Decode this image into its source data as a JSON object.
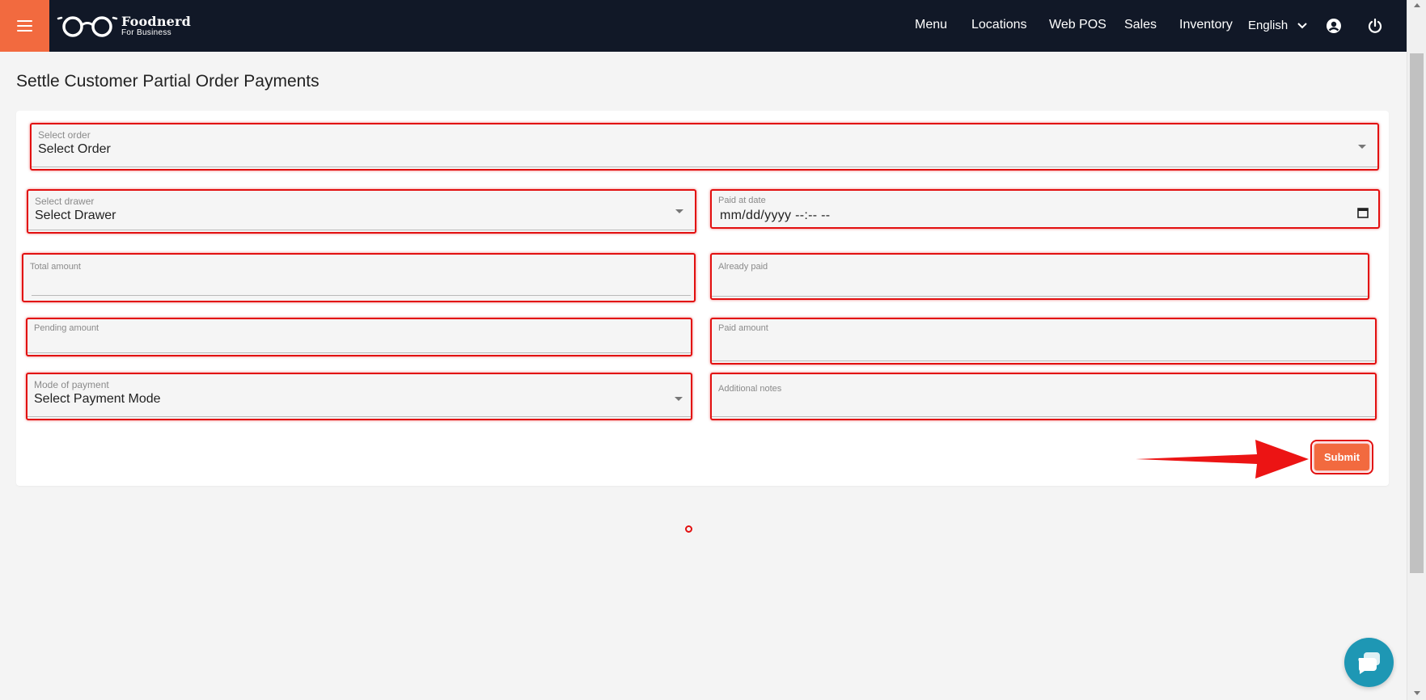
{
  "header": {
    "brand": "Foodnerd",
    "brand_sub": "For Business",
    "nav": [
      {
        "label": "Menu"
      },
      {
        "label": "Locations"
      },
      {
        "label": "Web POS"
      },
      {
        "label": "Sales"
      },
      {
        "label": "Inventory"
      }
    ],
    "language": "English",
    "icons": [
      "menu-icon",
      "glasses-logo-icon",
      "chevron-down-icon",
      "account-icon",
      "power-icon"
    ]
  },
  "page": {
    "title": "Settle Customer Partial Order Payments"
  },
  "form": {
    "order": {
      "label": "Select order",
      "value": "Select Order"
    },
    "drawer": {
      "label": "Select drawer",
      "value": "Select Drawer"
    },
    "paid_at": {
      "label": "Paid at date",
      "value": "mm/dd/yyyy --:-- --"
    },
    "total_amount": {
      "label": "Total amount",
      "value": ""
    },
    "already_paid": {
      "label": "Already paid",
      "value": ""
    },
    "pending_amount": {
      "label": "Pending amount",
      "value": ""
    },
    "paid_amount": {
      "label": "Paid amount",
      "value": ""
    },
    "payment_mode": {
      "label": "Mode of payment",
      "value": "Select Payment Mode"
    },
    "additional_notes": {
      "label": "Additional notes",
      "value": ""
    },
    "submit_label": "Submit"
  },
  "colors": {
    "header_bg": "#111827",
    "accent": "#f26a3f",
    "highlight": "#e21010",
    "chat": "#1e97b4"
  }
}
